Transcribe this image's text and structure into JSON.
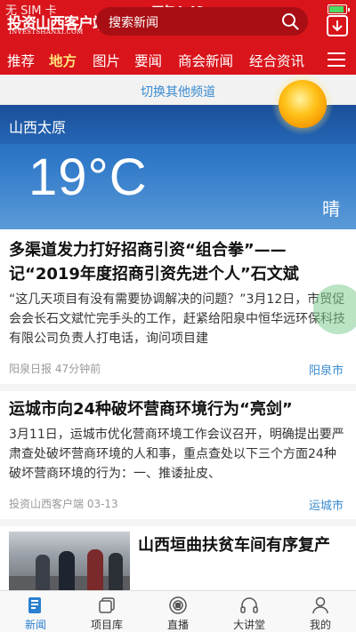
{
  "status_bar": {
    "carrier": "无 SIM 卡",
    "time": "下午4:48",
    "battery_level": 0.9
  },
  "header": {
    "logo_cn": "投资山西客户端",
    "logo_en": "INVESTSHANXI.COM",
    "search_placeholder": "搜索新闻",
    "brand_color": "#d9141b"
  },
  "channels": [
    {
      "label": "推荐",
      "active": false
    },
    {
      "label": "地方",
      "active": true
    },
    {
      "label": "图片",
      "active": false
    },
    {
      "label": "要闻",
      "active": false
    },
    {
      "label": "商会新闻",
      "active": false
    },
    {
      "label": "经合资讯",
      "active": false
    }
  ],
  "switch_channel": "切换其他频道",
  "weather": {
    "city": "山西太原",
    "temperature": "19°C",
    "condition": "晴"
  },
  "articles": [
    {
      "title": "多渠道发力打好招商引资“组合拳”——记“2019年度招商引资先进个人”石文斌",
      "summary": "“这几天项目有没有需要协调解决的问题？”3月12日，市贸促会会长石文斌忙完手头的工作，赶紧给阳泉中恒华远环保科技有限公司负责人打电话，询问项目建",
      "source": "阳泉日报 47分钟前",
      "tag": "阳泉市"
    },
    {
      "title": "运城市向24种破坏营商环境行为“亮剑”",
      "summary": "3月11日，运城市优化营商环境工作会议召开，明确提出要严肃查处破坏营商环境的人和事，重点查处以下三个方面24种破坏营商环境的行为：一、推诿扯皮、",
      "source": "投资山西客户端 03-13",
      "tag": "运城市"
    },
    {
      "title": "山西垣曲扶贫车间有序复产"
    }
  ],
  "tabbar": [
    {
      "label": "新闻",
      "icon": "news-icon",
      "active": true
    },
    {
      "label": "项目库",
      "icon": "project-library-icon",
      "active": false
    },
    {
      "label": "直播",
      "icon": "live-icon",
      "active": false
    },
    {
      "label": "大讲堂",
      "icon": "headphones-icon",
      "active": false
    },
    {
      "label": "我的",
      "icon": "profile-icon",
      "active": false
    }
  ]
}
